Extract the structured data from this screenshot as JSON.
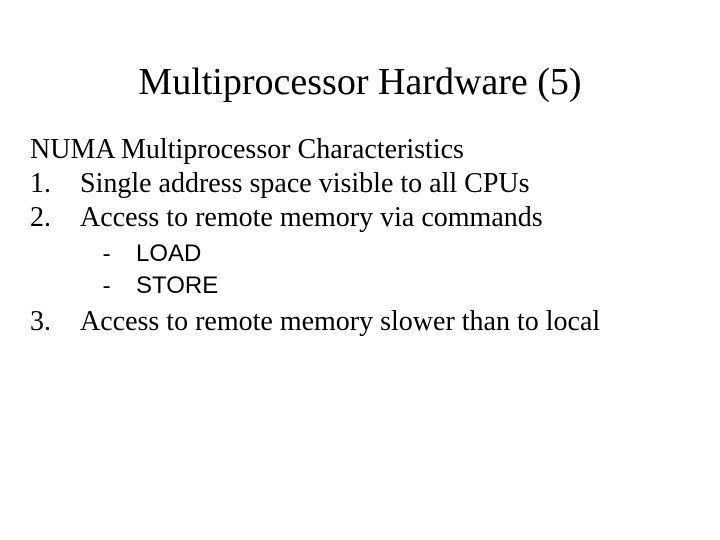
{
  "title": "Multiprocessor Hardware (5)",
  "subtitle": "NUMA Multiprocessor Characteristics",
  "items": [
    {
      "num": "1.",
      "text": "Single address space visible to all CPUs"
    },
    {
      "num": "2.",
      "text": "Access to remote memory via commands"
    },
    {
      "num": "3.",
      "text": "Access to remote memory slower than to local"
    }
  ],
  "subitems": [
    {
      "dash": "-",
      "text": "LOAD"
    },
    {
      "dash": "-",
      "text": "STORE"
    }
  ]
}
